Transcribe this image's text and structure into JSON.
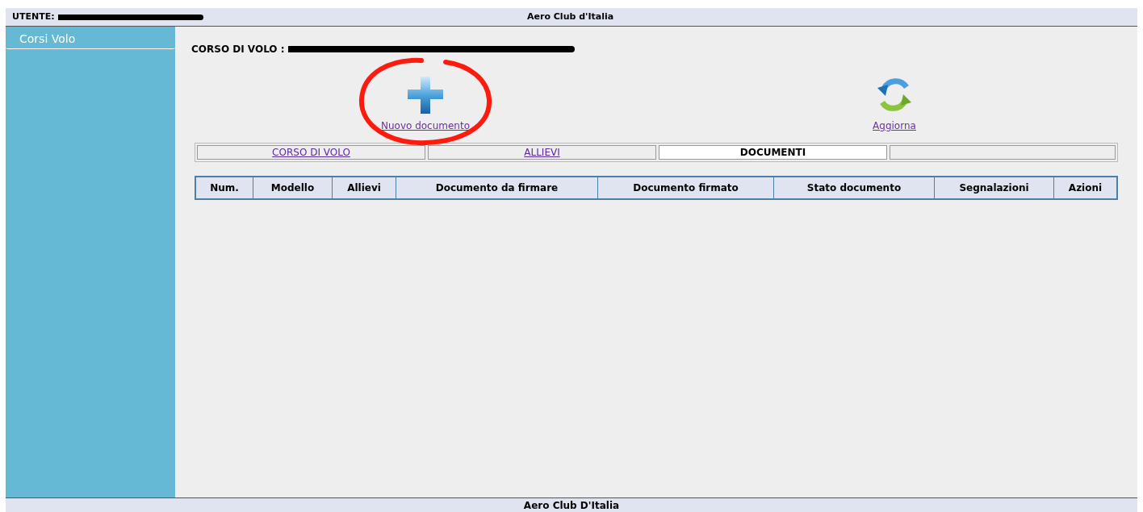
{
  "header": {
    "user_label": "UTENTE:",
    "title": "Aero Club d'Italia"
  },
  "sidebar": {
    "items": [
      {
        "label": "Corsi Volo",
        "selected": true
      }
    ]
  },
  "course": {
    "label": "CORSO DI VOLO :"
  },
  "actions": [
    {
      "kind": "add",
      "label": "Nuovo documento",
      "circled": true
    },
    {
      "kind": "refresh",
      "label": "Aggiorna",
      "circled": false
    }
  ],
  "tabs": [
    {
      "label": "CORSO DI VOLO",
      "selected": false
    },
    {
      "label": "ALLIEVI",
      "selected": false
    },
    {
      "label": "DOCUMENTI",
      "selected": true
    }
  ],
  "table": {
    "columns": [
      "Num.",
      "Modello",
      "Allievi",
      "Documento da firmare",
      "Documento firmato",
      "Stato documento",
      "Segnalazioni",
      "Azioni"
    ]
  },
  "footer": {
    "text": "Aero Club D'Italia"
  }
}
